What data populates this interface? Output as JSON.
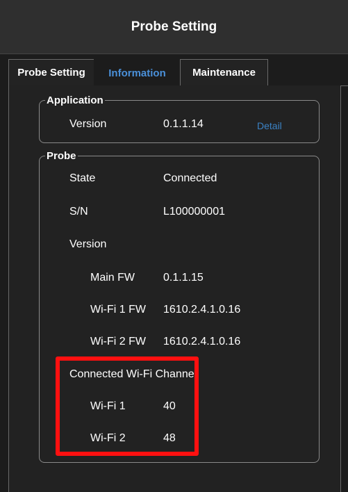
{
  "header": {
    "title": "Probe Setting"
  },
  "tabs": [
    {
      "label": "Probe Setting"
    },
    {
      "label": "Information"
    },
    {
      "label": "Maintenance"
    }
  ],
  "application": {
    "legend": "Application",
    "version_label": "Version",
    "version_value": "0.1.1.14",
    "detail_link": "Detail"
  },
  "probe": {
    "legend": "Probe",
    "state_label": "State",
    "state_value": "Connected",
    "sn_label": "S/N",
    "sn_value": "L100000001",
    "version_label": "Version",
    "main_fw_label": "Main FW",
    "main_fw_value": "0.1.1.15",
    "wifi1_fw_label": "Wi-Fi 1 FW",
    "wifi1_fw_value": "1610.2.4.1.0.16",
    "wifi2_fw_label": "Wi-Fi 2 FW",
    "wifi2_fw_value": "1610.2.4.1.0.16",
    "channel_heading": "Connected Wi-Fi Channel",
    "wifi1_label": "Wi-Fi 1",
    "wifi1_value": "40",
    "wifi2_label": "Wi-Fi 2",
    "wifi2_value": "48"
  },
  "colors": {
    "accent": "#4a90d9",
    "highlight": "#ff1010",
    "background": "#1c1c1c"
  }
}
